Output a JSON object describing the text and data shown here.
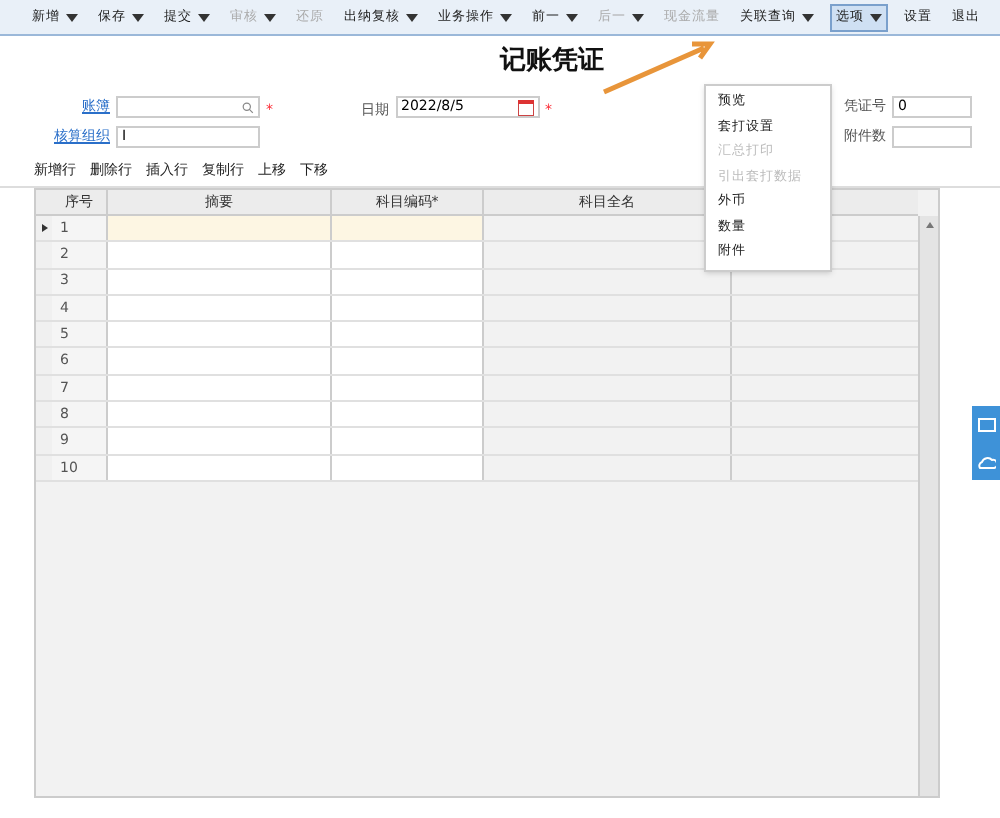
{
  "toolbar": [
    {
      "label": "新增",
      "dropdown": true,
      "disabled": false,
      "selected": false
    },
    {
      "label": "保存",
      "dropdown": true,
      "disabled": false,
      "selected": false
    },
    {
      "label": "提交",
      "dropdown": true,
      "disabled": false,
      "selected": false
    },
    {
      "label": "审核",
      "dropdown": true,
      "disabled": true,
      "selected": false
    },
    {
      "label": "还原",
      "dropdown": false,
      "disabled": true,
      "selected": false
    },
    {
      "label": "出纳复核",
      "dropdown": true,
      "disabled": false,
      "selected": false
    },
    {
      "label": "业务操作",
      "dropdown": true,
      "disabled": false,
      "selected": false
    },
    {
      "label": "前一",
      "dropdown": true,
      "disabled": false,
      "selected": false
    },
    {
      "label": "后一",
      "dropdown": true,
      "disabled": true,
      "selected": false
    },
    {
      "label": "现金流量",
      "dropdown": false,
      "disabled": true,
      "selected": false
    },
    {
      "label": "关联查询",
      "dropdown": true,
      "disabled": false,
      "selected": false
    },
    {
      "label": "选项",
      "dropdown": true,
      "disabled": false,
      "selected": true
    },
    {
      "label": "设置",
      "dropdown": false,
      "disabled": false,
      "selected": false
    },
    {
      "label": "退出",
      "dropdown": false,
      "disabled": false,
      "selected": false
    }
  ],
  "title": "记账凭证",
  "options_menu": [
    {
      "label": "预览",
      "disabled": false
    },
    {
      "label": "套打设置",
      "disabled": false
    },
    {
      "label": "汇总打印",
      "disabled": true
    },
    {
      "label": "引出套打数据",
      "disabled": true
    },
    {
      "label": "外币",
      "disabled": false
    },
    {
      "label": "数量",
      "disabled": false
    },
    {
      "label": "附件",
      "disabled": false
    }
  ],
  "fields": {
    "book": {
      "label": "账簿",
      "required": "*"
    },
    "org": {
      "label": "核算组织",
      "value": "I"
    },
    "date": {
      "label": "日期",
      "value": "2022/8/5",
      "required": "*"
    },
    "voucher_no": {
      "label": "凭证号",
      "value": "0"
    },
    "attachments": {
      "label": "附件数"
    }
  },
  "grid_toolbar": [
    "新增行",
    "删除行",
    "插入行",
    "复制行",
    "上移",
    "下移"
  ],
  "table": {
    "columns": [
      "序号",
      "摘要",
      "科目编码*",
      "科目全名"
    ],
    "rows": [
      {
        "no": "1",
        "selected": true
      },
      {
        "no": "2",
        "selected": false
      },
      {
        "no": "3",
        "selected": false
      },
      {
        "no": "4",
        "selected": false
      },
      {
        "no": "5",
        "selected": false
      },
      {
        "no": "6",
        "selected": false
      },
      {
        "no": "7",
        "selected": false
      },
      {
        "no": "8",
        "selected": false
      },
      {
        "no": "9",
        "selected": false
      },
      {
        "no": "10",
        "selected": false
      }
    ]
  }
}
